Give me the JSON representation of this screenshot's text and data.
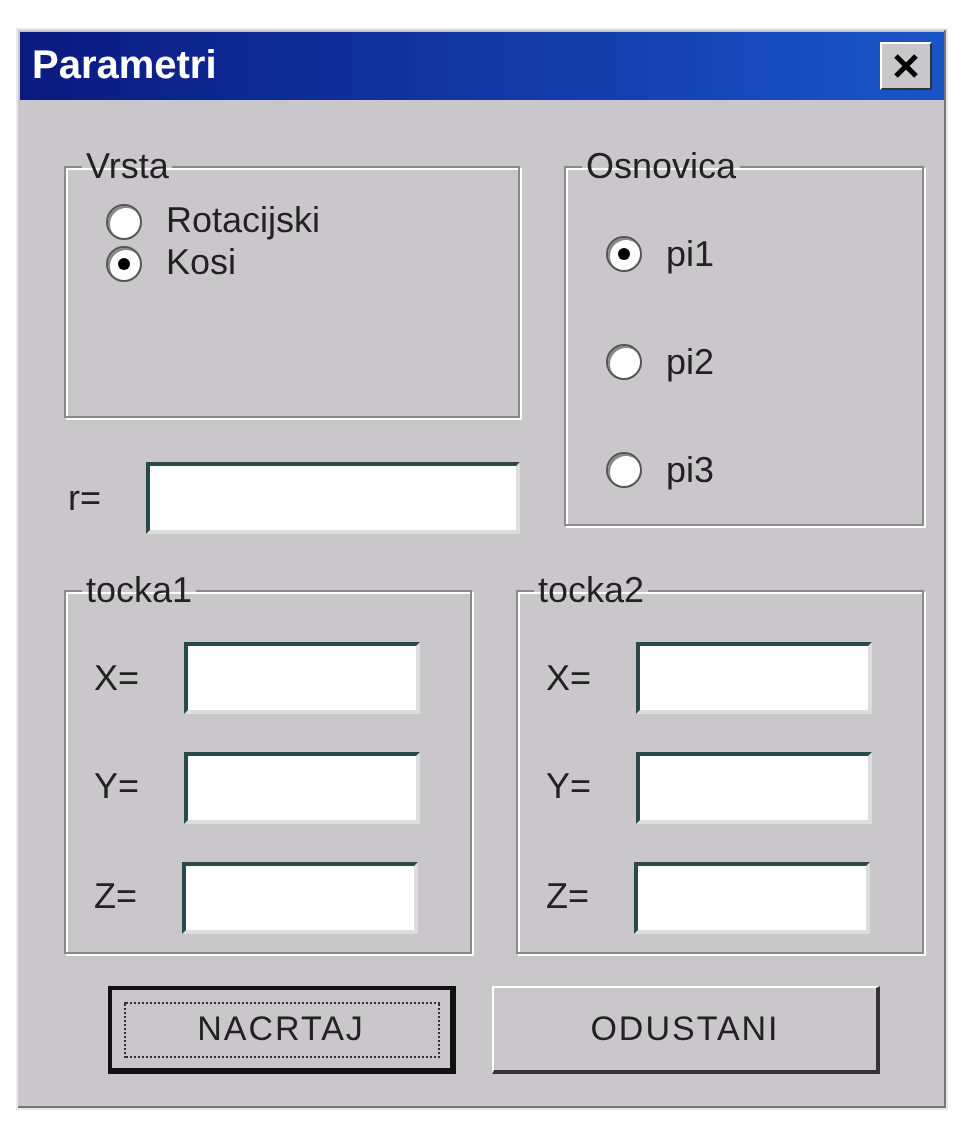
{
  "window": {
    "title": "Parametri"
  },
  "vrsta": {
    "label": "Vrsta",
    "options": [
      {
        "label": "Rotacijski",
        "selected": false
      },
      {
        "label": "Kosi",
        "selected": true
      }
    ]
  },
  "osnovica": {
    "label": "Osnovica",
    "options": [
      {
        "label": "pi1",
        "selected": true
      },
      {
        "label": "pi2",
        "selected": false
      },
      {
        "label": "pi3",
        "selected": false
      }
    ]
  },
  "r": {
    "label": "r="
  },
  "points": [
    {
      "label": "tocka1",
      "fields": [
        {
          "label": "X="
        },
        {
          "label": "Y="
        },
        {
          "label": "Z="
        }
      ]
    },
    {
      "label": "tocka2",
      "fields": [
        {
          "label": "X="
        },
        {
          "label": "Y="
        },
        {
          "label": "Z="
        }
      ]
    }
  ],
  "buttons": [
    {
      "label": "NACRTAJ",
      "default": true
    },
    {
      "label": "ODUSTANI",
      "default": false
    }
  ]
}
